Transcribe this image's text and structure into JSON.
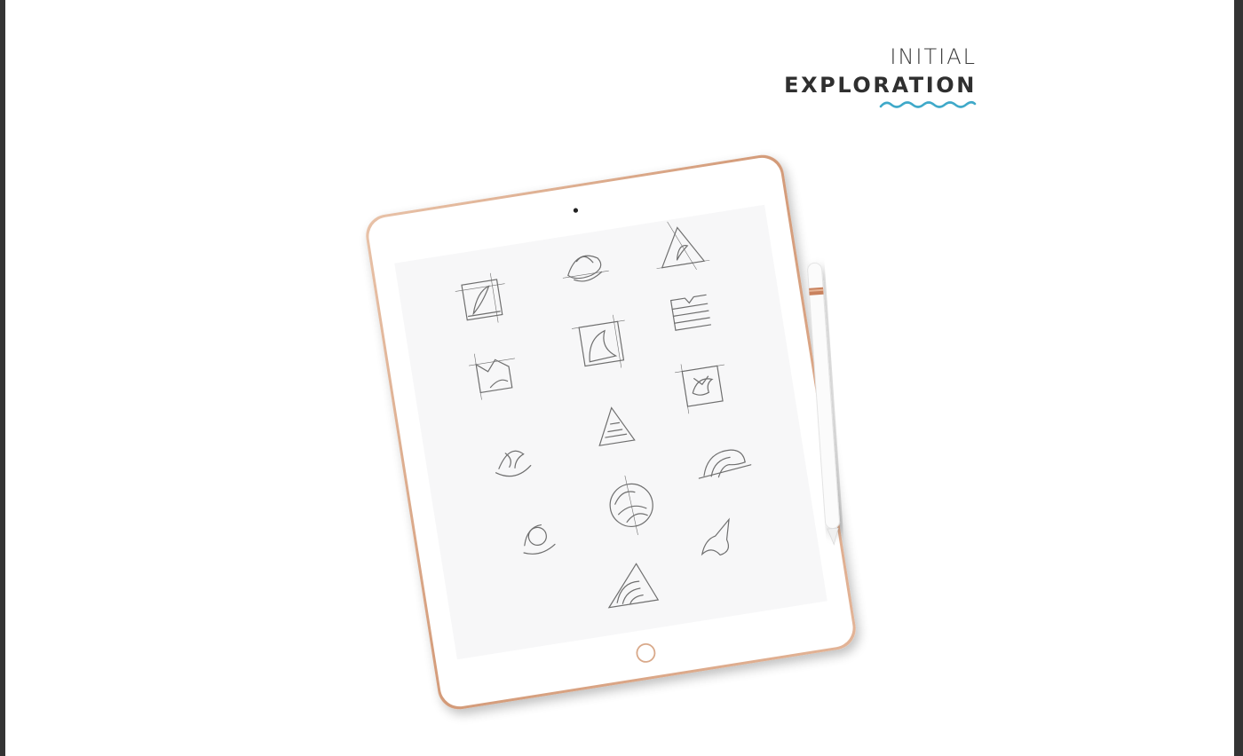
{
  "heading": {
    "line1": "INITIAL",
    "line2": "EXPLORATION"
  },
  "colors": {
    "background": "#ffffff",
    "frame": "#343434",
    "accent_wave": "#3fa9c9",
    "tablet_rim": "#d9a98a",
    "pencil_band": "#c9825e"
  },
  "icons": [
    "tablet-icon",
    "apple-pencil-icon",
    "wave-icon",
    "logo-sketch-icon"
  ]
}
